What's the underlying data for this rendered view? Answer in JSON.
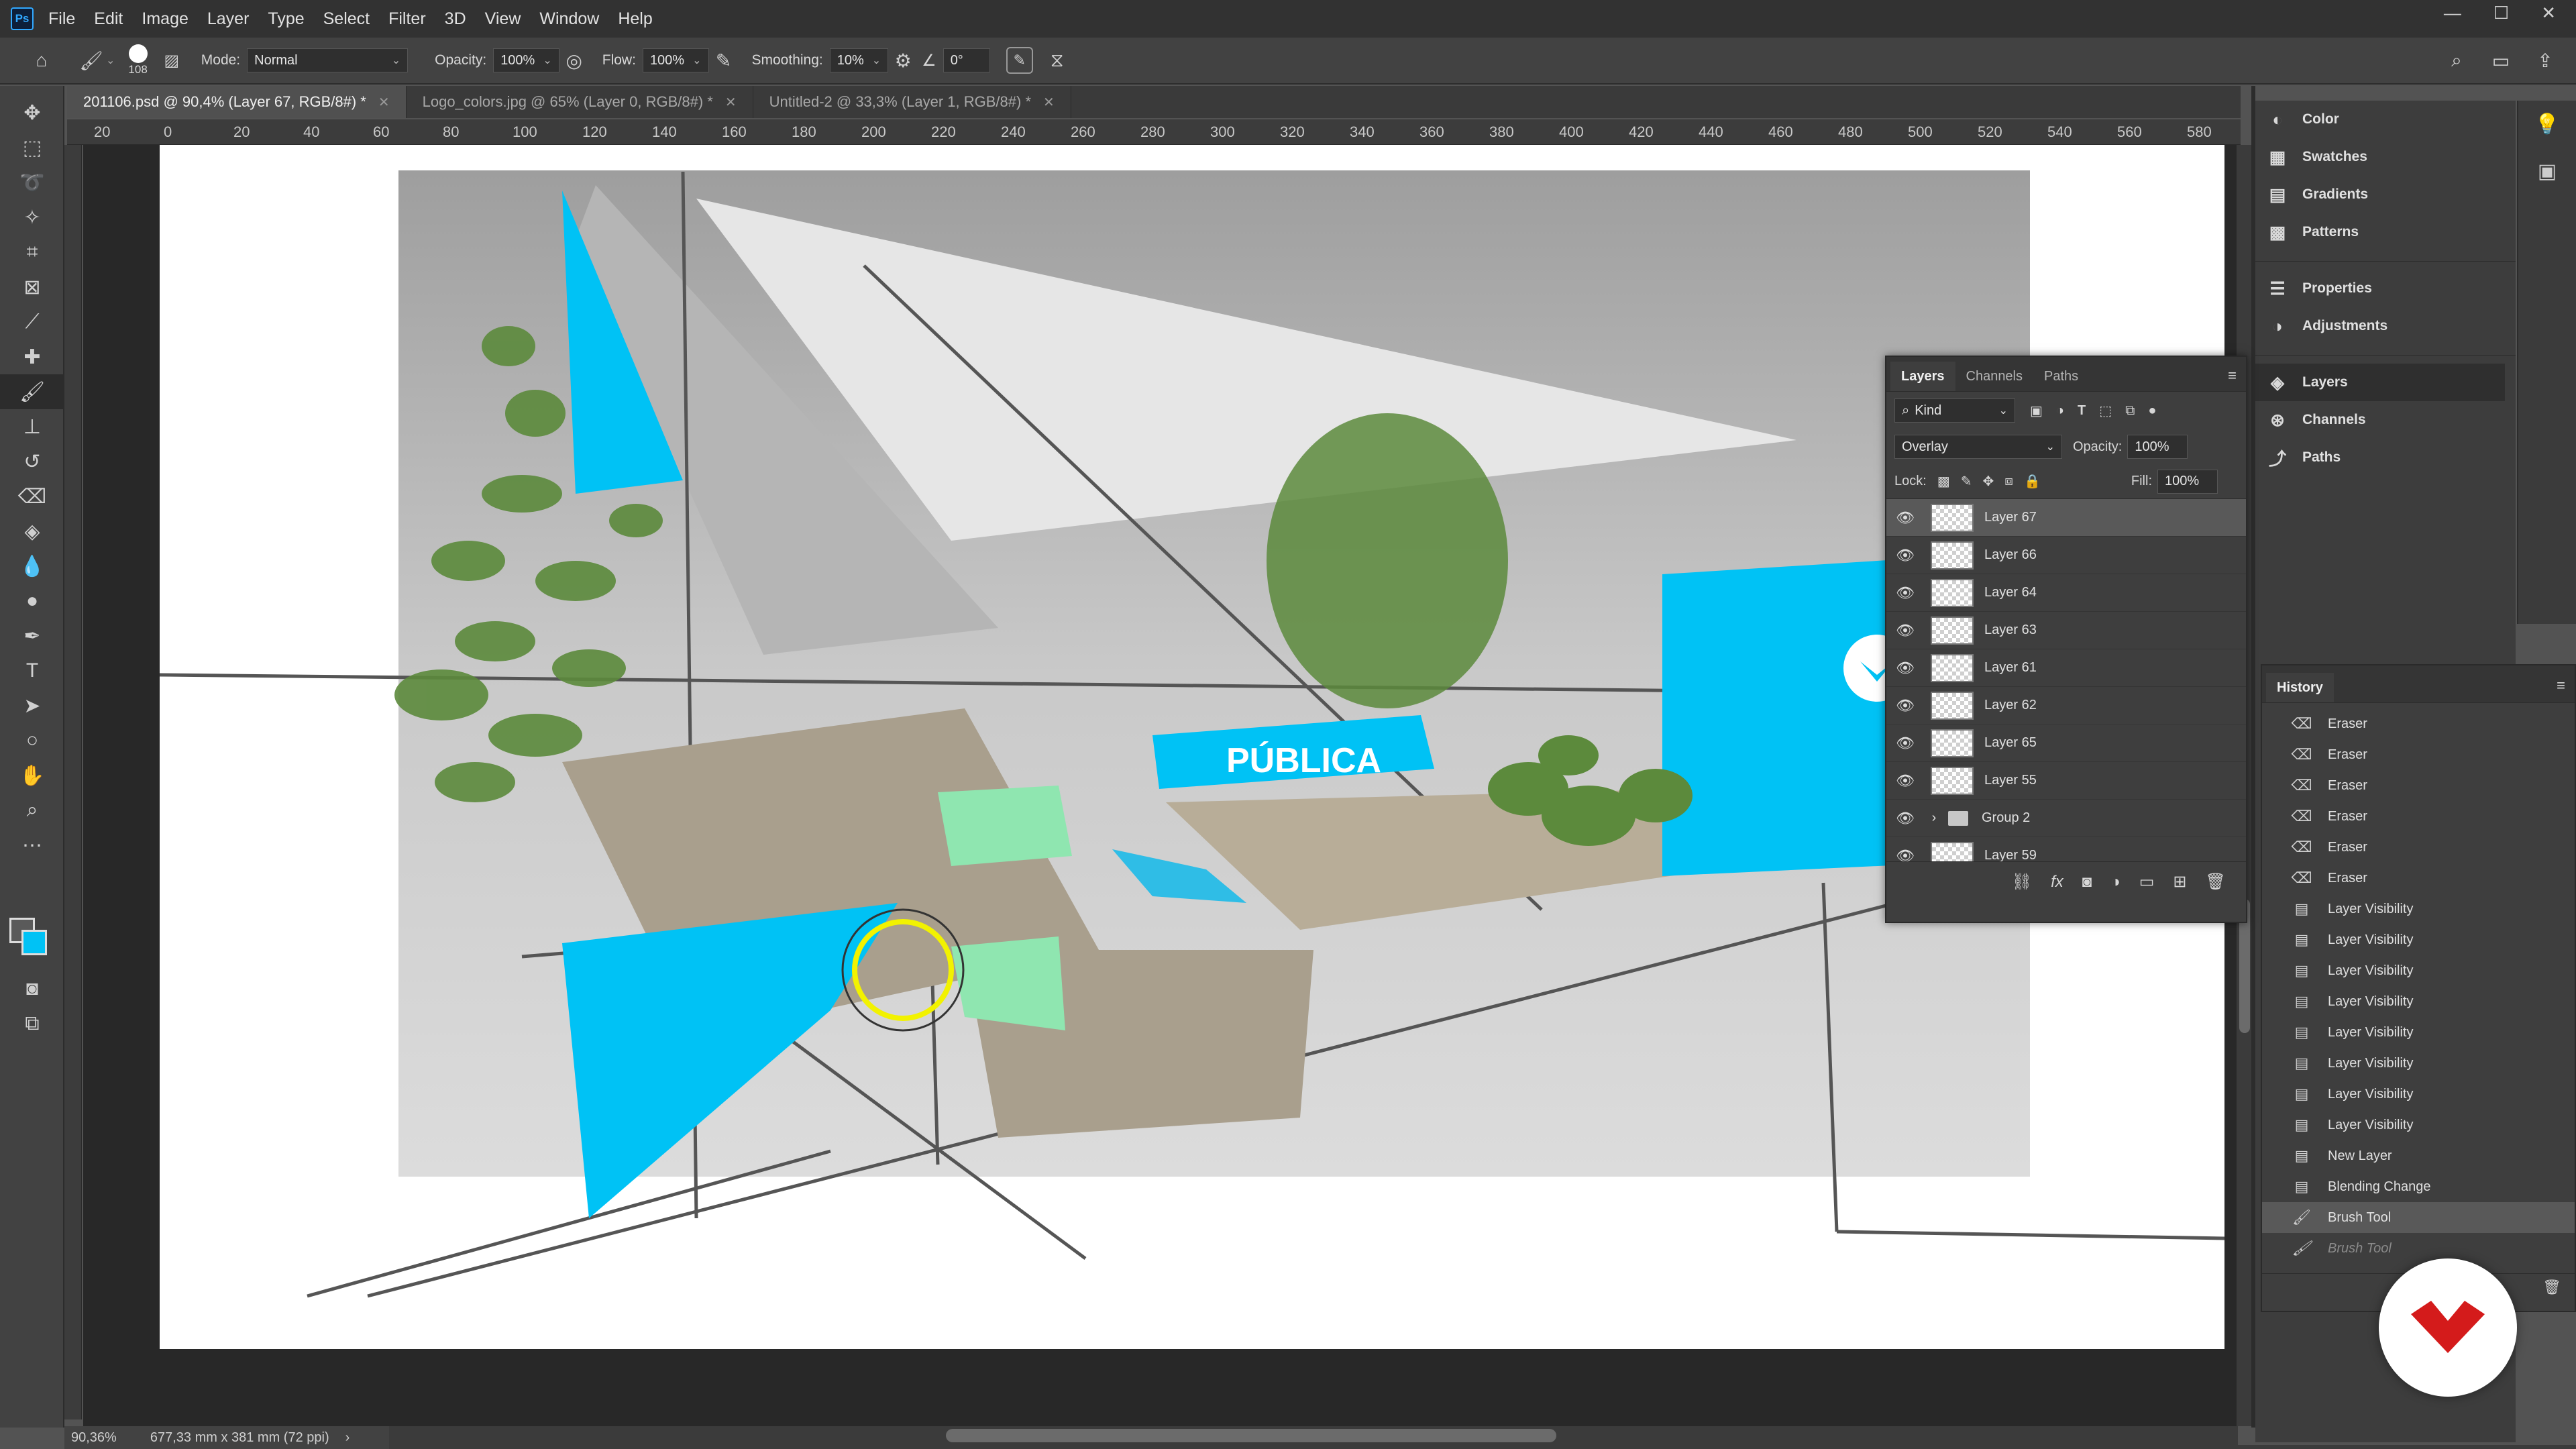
{
  "app": {
    "logo_text": "Ps",
    "menu": [
      "File",
      "Edit",
      "Image",
      "Layer",
      "Type",
      "Select",
      "Filter",
      "3D",
      "View",
      "Window",
      "Help"
    ]
  },
  "options_bar": {
    "brush_size": "108",
    "mode_label": "Mode:",
    "mode_value": "Normal",
    "opacity_label": "Opacity:",
    "opacity_value": "100%",
    "flow_label": "Flow:",
    "flow_value": "100%",
    "smoothing_label": "Smoothing:",
    "smoothing_value": "10%",
    "angle_value": "0°"
  },
  "tabs": [
    {
      "label": "201106.psd @ 90,4% (Layer 67, RGB/8#) *"
    },
    {
      "label": "Logo_colors.jpg @ 65% (Layer 0, RGB/8#) *"
    },
    {
      "label": "Untitled-2 @ 33,3% (Layer 1, RGB/8#) *"
    }
  ],
  "ruler_top": [
    "20",
    "0",
    "20",
    "40",
    "60",
    "80",
    "100",
    "120",
    "140",
    "160",
    "180",
    "200",
    "220",
    "240",
    "260",
    "280",
    "300",
    "320",
    "340",
    "360",
    "380",
    "400",
    "420",
    "440",
    "460",
    "480",
    "500",
    "520",
    "540",
    "560",
    "580"
  ],
  "canvas": {
    "sign_text": "PÚBLICA",
    "accent": "#00c2f5",
    "plant_green": "#5c8a3c"
  },
  "status": {
    "zoom": "90,36%",
    "doc_size": "677,33 mm x 381 mm (72 ppi)"
  },
  "dock": {
    "items": [
      "Color",
      "Swatches",
      "Gradients",
      "Patterns",
      "Properties",
      "Adjustments",
      "Layers",
      "Channels",
      "Paths"
    ]
  },
  "layers_panel": {
    "tabs": [
      "Layers",
      "Channels",
      "Paths"
    ],
    "kind_label": "Kind",
    "blend_mode": "Overlay",
    "opacity_label": "Opacity:",
    "opacity_value": "100%",
    "lock_label": "Lock:",
    "fill_label": "Fill:",
    "fill_value": "100%",
    "layers": [
      "Layer 67",
      "Layer 66",
      "Layer 64",
      "Layer 63",
      "Layer 61",
      "Layer 62",
      "Layer 65",
      "Layer 55",
      "Group 2",
      "Layer 59"
    ]
  },
  "history_panel": {
    "title": "History",
    "items": [
      "Eraser",
      "Eraser",
      "Eraser",
      "Eraser",
      "Eraser",
      "Eraser",
      "Layer Visibility",
      "Layer Visibility",
      "Layer Visibility",
      "Layer Visibility",
      "Layer Visibility",
      "Layer Visibility",
      "Layer Visibility",
      "Layer Visibility",
      "New Layer",
      "Blending Change",
      "Brush Tool",
      "Brush Tool"
    ]
  }
}
